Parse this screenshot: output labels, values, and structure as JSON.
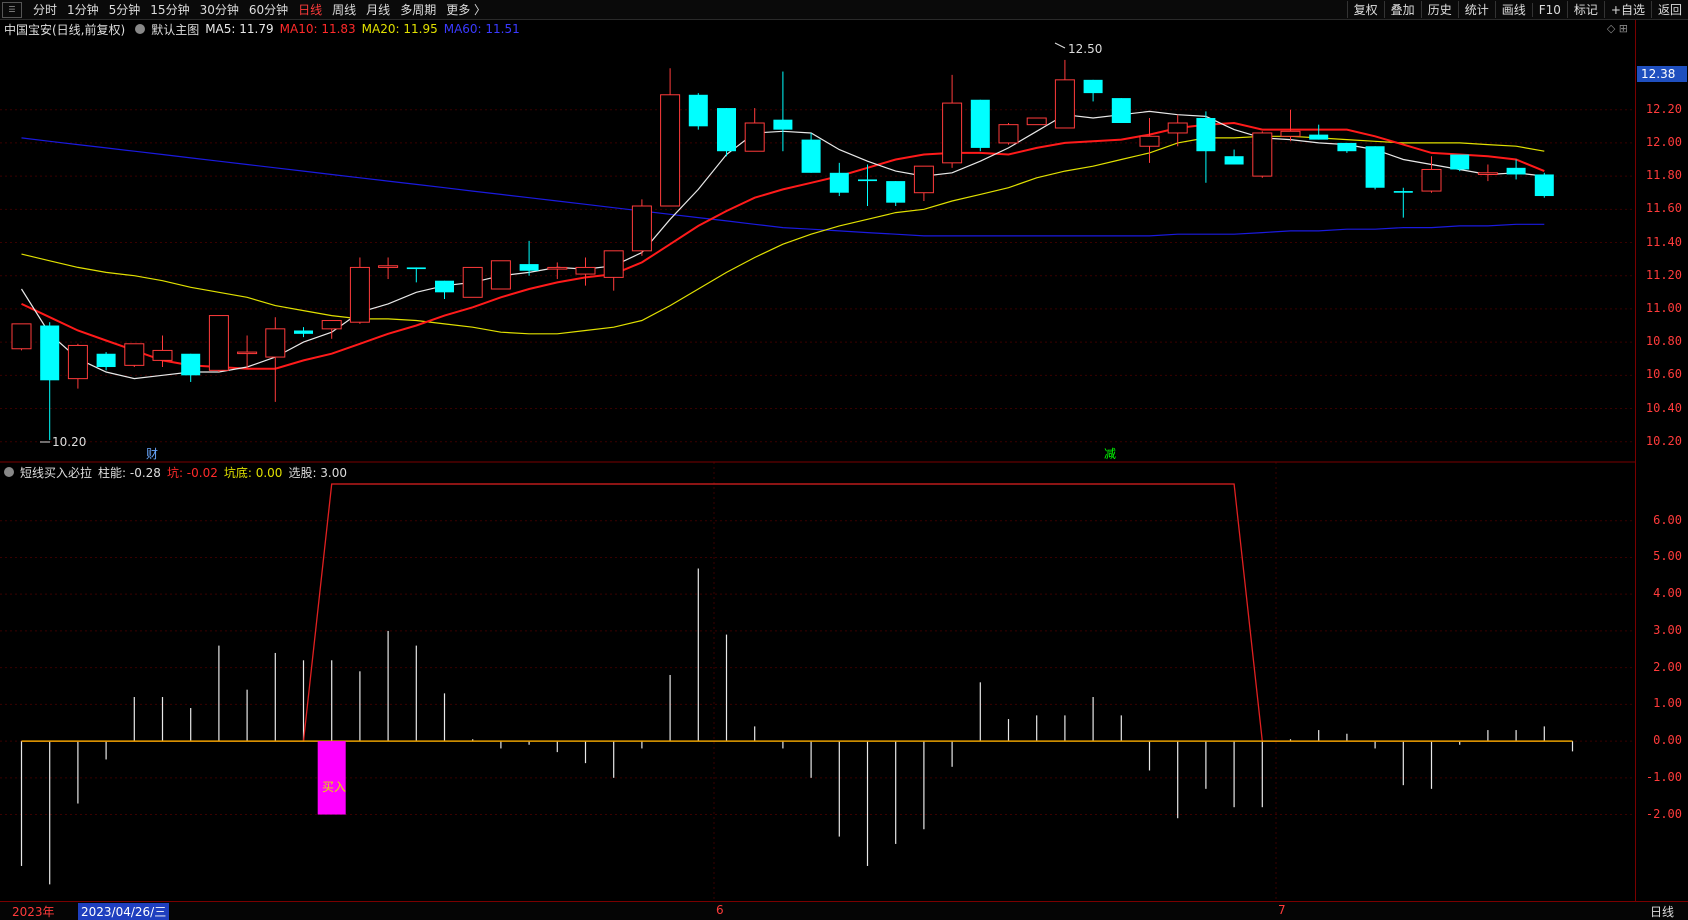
{
  "topbar": {
    "periods": [
      "分时",
      "1分钟",
      "5分钟",
      "15分钟",
      "30分钟",
      "60分钟",
      "日线",
      "周线",
      "月线",
      "多周期",
      "更多 〉"
    ],
    "active_period": "日线",
    "tools": [
      "复权",
      "叠加",
      "历史",
      "统计",
      "画线",
      "F10",
      "标记",
      "+自选",
      "返回"
    ]
  },
  "main_info": {
    "title": "中国宝安(日线,前复权)",
    "template": "默认主图",
    "ma5": "MA5: 11.79",
    "ma10": "MA10: 11.83",
    "ma20": "MA20: 11.95",
    "ma60": "MA60: 11.51"
  },
  "indicator_info": {
    "name": "短线买入必拉",
    "zhuneng": "柱能: -0.28",
    "keng": "坑: -0.02",
    "kengdi": "坑底: 0.00",
    "xuangu": "选股: 3.00"
  },
  "colors": {
    "up": "#ff3b3b",
    "down": "#00ffff",
    "ma5": "#e8e8e8",
    "ma10": "#ff1a1a",
    "ma20": "#e0e000",
    "ma60": "#1a1adf",
    "buy": "#ff00ff"
  },
  "price_axis": [
    "12.20",
    "12.00",
    "11.80",
    "11.60",
    "11.40",
    "11.20",
    "11.00",
    "10.80",
    "10.60",
    "10.40",
    "10.20"
  ],
  "current_price": "12.38",
  "indicator_axis": [
    "6.00",
    "5.00",
    "4.00",
    "3.00",
    "2.00",
    "1.00",
    "0.00",
    "-1.00",
    "-2.00"
  ],
  "annotations": {
    "high": "12.50",
    "low": "10.20",
    "event1": "财",
    "event2": "减",
    "buy_label": "买入"
  },
  "bottom": {
    "year": "2023年",
    "cursor_date": "2023/04/26/三",
    "month6": "6",
    "month7": "7",
    "period": "日线"
  },
  "chart_data": {
    "type": "candlestick",
    "ylim": [
      10.12,
      12.62
    ],
    "candles": [
      [
        10.76,
        10.91,
        10.75,
        10.91
      ],
      [
        10.9,
        10.92,
        10.21,
        10.57
      ],
      [
        10.58,
        10.79,
        10.52,
        10.78
      ],
      [
        10.73,
        10.74,
        10.63,
        10.65
      ],
      [
        10.66,
        10.78,
        10.65,
        10.79
      ],
      [
        10.69,
        10.84,
        10.65,
        10.75
      ],
      [
        10.73,
        10.73,
        10.56,
        10.6
      ],
      [
        10.63,
        10.94,
        10.62,
        10.96
      ],
      [
        10.74,
        10.84,
        10.64,
        10.74
      ],
      [
        10.71,
        10.95,
        10.44,
        10.88
      ],
      [
        10.87,
        10.89,
        10.83,
        10.85
      ],
      [
        10.88,
        10.92,
        10.82,
        10.93
      ],
      [
        10.92,
        11.31,
        10.91,
        11.25
      ],
      [
        11.25,
        11.31,
        11.18,
        11.26
      ],
      [
        11.25,
        11.25,
        11.16,
        11.24
      ],
      [
        11.17,
        11.16,
        11.06,
        11.1
      ],
      [
        11.07,
        11.18,
        11.1,
        11.25
      ],
      [
        11.12,
        11.27,
        11.12,
        11.29
      ],
      [
        11.27,
        11.41,
        11.2,
        11.23
      ],
      [
        11.24,
        11.28,
        11.18,
        11.25
      ],
      [
        11.21,
        11.31,
        11.14,
        11.25
      ],
      [
        11.19,
        11.34,
        11.11,
        11.35
      ],
      [
        11.35,
        11.66,
        11.32,
        11.62
      ],
      [
        11.62,
        12.45,
        11.62,
        12.29
      ],
      [
        12.29,
        12.3,
        12.08,
        12.1
      ],
      [
        12.21,
        12.2,
        11.92,
        11.95
      ],
      [
        11.95,
        12.21,
        11.95,
        12.12
      ],
      [
        12.14,
        12.43,
        11.95,
        12.08
      ],
      [
        12.02,
        12.06,
        11.85,
        11.82
      ],
      [
        11.82,
        11.88,
        11.68,
        11.7
      ],
      [
        11.78,
        11.87,
        11.62,
        11.77
      ],
      [
        11.77,
        11.7,
        11.62,
        11.64
      ],
      [
        11.7,
        11.86,
        11.65,
        11.86
      ],
      [
        11.88,
        12.41,
        11.85,
        12.24
      ],
      [
        12.26,
        12.23,
        11.95,
        11.97
      ],
      [
        12.0,
        12.12,
        11.99,
        12.11
      ],
      [
        12.11,
        12.15,
        12.11,
        12.15
      ],
      [
        12.09,
        12.5,
        12.1,
        12.38
      ],
      [
        12.38,
        12.35,
        12.25,
        12.3
      ],
      [
        12.27,
        12.27,
        12.12,
        12.12
      ],
      [
        11.98,
        12.15,
        11.88,
        12.04
      ],
      [
        12.06,
        12.17,
        11.98,
        12.12
      ],
      [
        12.15,
        12.19,
        11.76,
        11.95
      ],
      [
        11.92,
        11.96,
        11.89,
        11.87
      ],
      [
        11.8,
        12.07,
        11.79,
        12.06
      ],
      [
        12.04,
        12.2,
        12.01,
        12.07
      ],
      [
        12.05,
        12.11,
        12.04,
        12.02
      ],
      [
        12.0,
        12.0,
        11.94,
        11.95
      ],
      [
        11.98,
        11.96,
        11.72,
        11.73
      ],
      [
        11.71,
        11.73,
        11.55,
        11.7
      ],
      [
        11.71,
        11.92,
        11.7,
        11.84
      ],
      [
        11.93,
        11.92,
        11.83,
        11.84
      ],
      [
        11.81,
        11.87,
        11.77,
        11.82
      ],
      [
        11.85,
        11.9,
        11.78,
        11.81
      ],
      [
        11.81,
        11.82,
        11.67,
        11.68
      ]
    ],
    "ma5": [
      11.12,
      10.85,
      10.7,
      10.62,
      10.58,
      10.6,
      10.62,
      10.62,
      10.65,
      10.71,
      10.8,
      10.86,
      10.98,
      11.03,
      11.1,
      11.14,
      11.16,
      11.2,
      11.22,
      11.25,
      11.24,
      11.26,
      11.34,
      11.54,
      11.72,
      11.93,
      12.06,
      12.07,
      12.06,
      11.96,
      11.89,
      11.83,
      11.8,
      11.82,
      11.89,
      11.97,
      12.07,
      12.17,
      12.15,
      12.17,
      12.19,
      12.17,
      12.16,
      12.08,
      12.03,
      12.02,
      12.0,
      11.99,
      11.96,
      11.9,
      11.87,
      11.84,
      11.81,
      11.82,
      11.8
    ],
    "ma10": [
      11.03,
      10.95,
      10.87,
      10.81,
      10.75,
      10.69,
      10.66,
      10.65,
      10.64,
      10.64,
      10.69,
      10.73,
      10.79,
      10.85,
      10.9,
      10.96,
      11.01,
      11.07,
      11.12,
      11.16,
      11.19,
      11.21,
      11.28,
      11.39,
      11.5,
      11.59,
      11.67,
      11.72,
      11.76,
      11.8,
      11.85,
      11.9,
      11.93,
      11.94,
      11.94,
      11.93,
      11.97,
      12.0,
      12.01,
      12.02,
      12.05,
      12.09,
      12.11,
      12.12,
      12.08,
      12.08,
      12.08,
      12.08,
      12.04,
      11.99,
      11.94,
      11.93,
      11.92,
      11.9,
      11.83
    ],
    "ma20": [
      11.33,
      11.29,
      11.25,
      11.22,
      11.2,
      11.17,
      11.13,
      11.1,
      11.07,
      11.02,
      10.99,
      10.96,
      10.94,
      10.94,
      10.93,
      10.91,
      10.89,
      10.86,
      10.85,
      10.85,
      10.87,
      10.89,
      10.93,
      11.02,
      11.12,
      11.22,
      11.31,
      11.39,
      11.45,
      11.5,
      11.54,
      11.58,
      11.6,
      11.65,
      11.69,
      11.73,
      11.79,
      11.83,
      11.86,
      11.9,
      11.94,
      12.0,
      12.03,
      12.03,
      12.04,
      12.04,
      12.03,
      12.02,
      12.01,
      12.0,
      12.0,
      12.0,
      11.99,
      11.98,
      11.95
    ],
    "ma60": [
      12.03,
      12.01,
      11.99,
      11.97,
      11.95,
      11.93,
      11.91,
      11.89,
      11.87,
      11.85,
      11.83,
      11.81,
      11.79,
      11.77,
      11.75,
      11.73,
      11.71,
      11.69,
      11.67,
      11.65,
      11.63,
      11.61,
      11.59,
      11.57,
      11.55,
      11.53,
      11.51,
      11.49,
      11.48,
      11.47,
      11.46,
      11.45,
      11.44,
      11.44,
      11.44,
      11.44,
      11.44,
      11.44,
      11.44,
      11.44,
      11.44,
      11.45,
      11.45,
      11.45,
      11.46,
      11.47,
      11.47,
      11.48,
      11.48,
      11.49,
      11.49,
      11.5,
      11.5,
      11.51,
      11.51
    ],
    "indicator_ylim": [
      -4.0,
      7.0
    ],
    "bars": [
      -3.4,
      -3.9,
      -1.7,
      -0.5,
      1.2,
      1.2,
      0.9,
      2.6,
      1.4,
      2.4,
      2.2,
      2.2,
      1.9,
      3.0,
      2.6,
      1.3,
      0.05,
      -0.2,
      -0.1,
      -0.3,
      -0.6,
      -1.0,
      -0.2,
      1.8,
      4.7,
      2.9,
      0.4,
      -0.2,
      -1.0,
      -2.6,
      -3.4,
      -2.8,
      -2.4,
      -0.7,
      1.6,
      0.6,
      0.7,
      0.7,
      1.2,
      0.7,
      -0.8,
      -2.1,
      -1.3,
      -1.8,
      -1.8,
      0.05,
      0.3,
      0.2,
      -0.2,
      -1.2,
      -1.3,
      -0.1,
      0.3,
      0.3,
      0.4,
      -0.28
    ],
    "xuangu_line": [
      0,
      0,
      0,
      0,
      0,
      0,
      0,
      0,
      0,
      0,
      0,
      7.0,
      7.0,
      7.0,
      7.0,
      7.0,
      7.0,
      7.0,
      7.0,
      7.0,
      7.0,
      7.0,
      7.0,
      7.0,
      7.0,
      7.0,
      7.0,
      7.0,
      7.0,
      7.0,
      7.0,
      7.0,
      7.0,
      7.0,
      7.0,
      7.0,
      7.0,
      7.0,
      7.0,
      7.0,
      7.0,
      7.0,
      7.0,
      7.0,
      0,
      0,
      0,
      0,
      0,
      0,
      0,
      0,
      0,
      0,
      0
    ],
    "buy_signal": {
      "index": 11,
      "value": -2.0
    }
  }
}
